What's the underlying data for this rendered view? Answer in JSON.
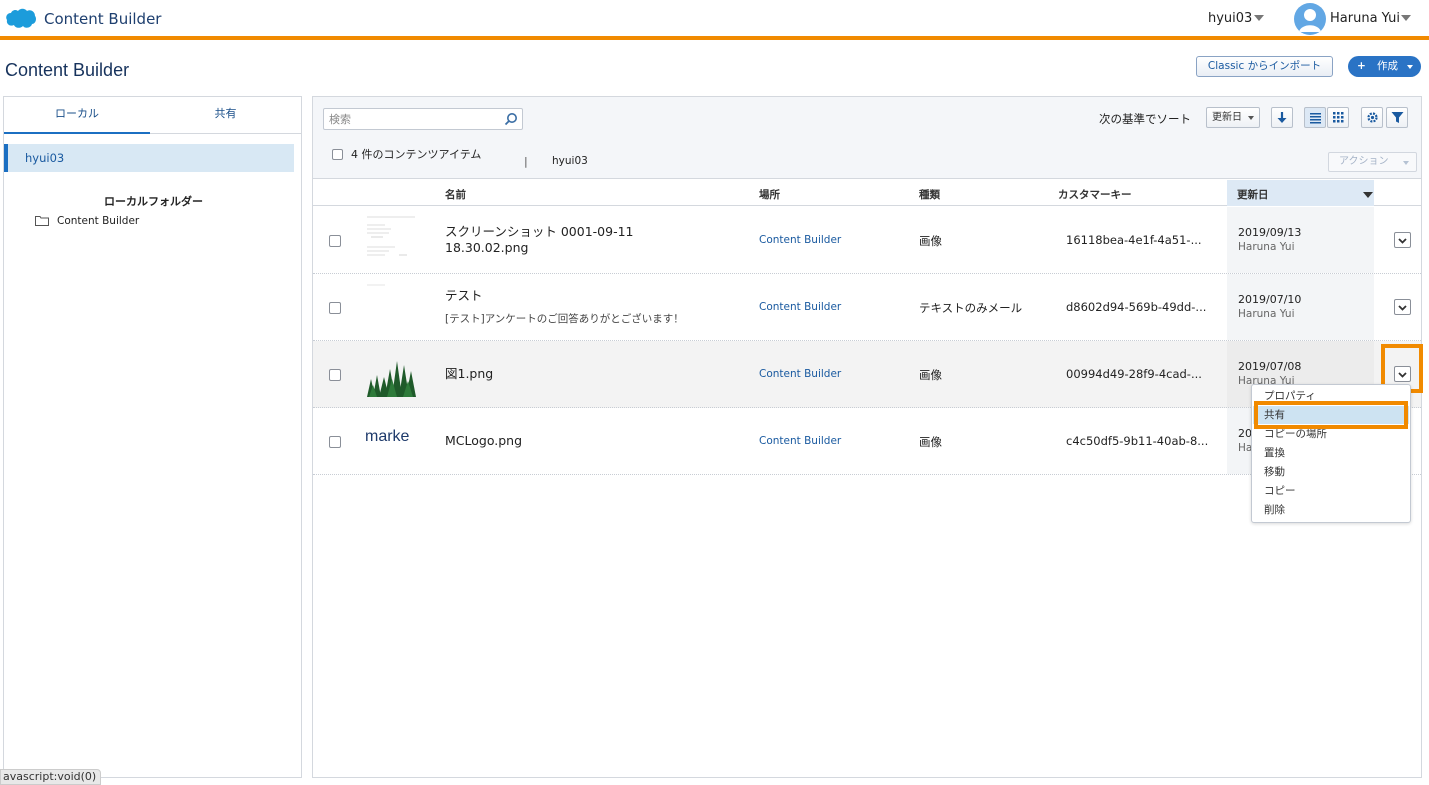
{
  "header": {
    "app_title": "Content Builder",
    "business_unit": "hyui03",
    "user_name": "Haruna Yui",
    "accent_color": "#f18a00"
  },
  "page": {
    "title": "Content Builder",
    "import_button": "Classic からインポート",
    "create_button": "作成"
  },
  "sidebar": {
    "tabs": [
      "ローカル",
      "共有"
    ],
    "business_unit_item": "hyui03",
    "folder_heading": "ローカルフォルダー",
    "folders": [
      "Content Builder"
    ]
  },
  "toolbar": {
    "search_placeholder": "検索",
    "sort_label": "次の基準でソート",
    "sort_value": "更新日",
    "items_count": "4 件のコンテンツアイテム",
    "separator": "|",
    "path": "hyui03",
    "action_button": "アクション"
  },
  "table": {
    "columns": [
      "名前",
      "場所",
      "種類",
      "カスタマーキー",
      "更新日"
    ],
    "rows": [
      {
        "name": "スクリーンショット 0001-09-11 18.30.02.png",
        "name_line1": "スクリーンショット 0001-09-11",
        "name_line2": "18.30.02.png",
        "subtitle": "",
        "location": "Content Builder",
        "type": "画像",
        "customer_key": "16118bea-4e1f-4a51-...",
        "date": "2019/09/13",
        "author": "Haruna Yui",
        "thumb": "screenshot-thumbnail"
      },
      {
        "name": "テスト",
        "subtitle": "[テスト]アンケートのご回答ありがとございます！",
        "location": "Content Builder",
        "type": "テキストのみメール",
        "customer_key": "d8602d94-569b-49dd-...",
        "date": "2019/07/10",
        "author": "Haruna Yui",
        "thumb": "email-thumbnail"
      },
      {
        "name": "図1.png",
        "subtitle": "",
        "location": "Content Builder",
        "type": "画像",
        "customer_key": "00994d49-28f9-4cad-...",
        "date": "2019/07/08",
        "author": "Haruna Yui",
        "thumb": "trees-thumbnail"
      },
      {
        "name": "MCLogo.png",
        "subtitle": "",
        "location": "Content Builder",
        "type": "画像",
        "customer_key": "c4c50df5-9b11-40ab-8...",
        "date": "20",
        "author": "Ha",
        "thumb_text": "marke"
      }
    ]
  },
  "row_menu": {
    "items": [
      "プロパティ",
      "共有",
      "コピーの場所",
      "置換",
      "移動",
      "コピー",
      "削除"
    ],
    "active_index": 1
  },
  "status_bar": "avascript:void(0)"
}
